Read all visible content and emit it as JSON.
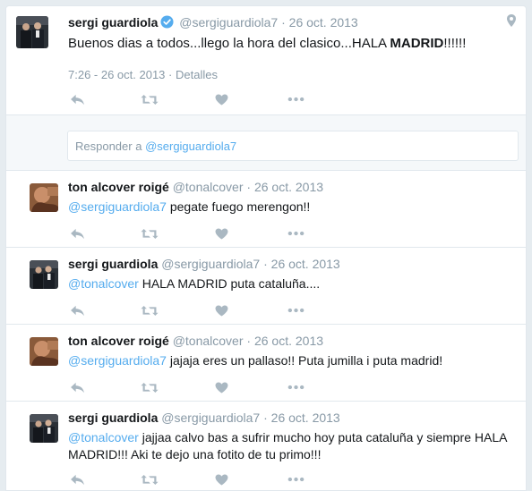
{
  "main_tweet": {
    "name": "sergi guardiola",
    "handle": "@sergiguardiola7",
    "separator": "·",
    "date": "26 oct. 2013",
    "text_before": "Buenos dias a todos...llego la hora del clasico...HALA ",
    "text_bold": "MADRID",
    "text_after": "!!!!!!",
    "timestamp": "7:26 - 26 oct. 2013",
    "meta_separator": "·",
    "details_label": "Detalles"
  },
  "reply_box": {
    "prefix": "Responder a ",
    "mention": "@sergiguardiola7"
  },
  "replies": [
    {
      "name": "ton alcover roigé",
      "handle": "@tonalcover",
      "separator": "·",
      "date": "26 oct. 2013",
      "mention": "@sergiguardiola7",
      "text": " pegate fuego merengon!!"
    },
    {
      "name": "sergi guardiola",
      "handle": "@sergiguardiola7",
      "separator": "·",
      "date": "26 oct. 2013",
      "mention": "@tonalcover",
      "text": " HALA MADRID puta cataluña...."
    },
    {
      "name": "ton alcover roigé",
      "handle": "@tonalcover",
      "separator": "·",
      "date": "26 oct. 2013",
      "mention": "@sergiguardiola7",
      "text": " jajaja eres un pallaso!! Puta jumilla i puta madrid!"
    },
    {
      "name": "sergi guardiola",
      "handle": "@sergiguardiola7",
      "separator": "·",
      "date": "26 oct. 2013",
      "mention": "@tonalcover",
      "text": " jajjaa calvo bas a sufrir mucho hoy puta cataluña y siempre HALA MADRID!!! Aki te dejo una fotito de tu primo!!!"
    }
  ],
  "icons": {
    "reply": "reply-arrow-icon",
    "retweet": "retweet-icon",
    "like": "heart-icon",
    "more": "more-dots-icon",
    "verified": "verified-badge-icon",
    "location": "location-pin-icon"
  },
  "colors": {
    "background": "#e6ecf0",
    "link": "#55acee",
    "muted": "#8899a6",
    "icon": "#aab8c2",
    "verified": "#55acee"
  }
}
